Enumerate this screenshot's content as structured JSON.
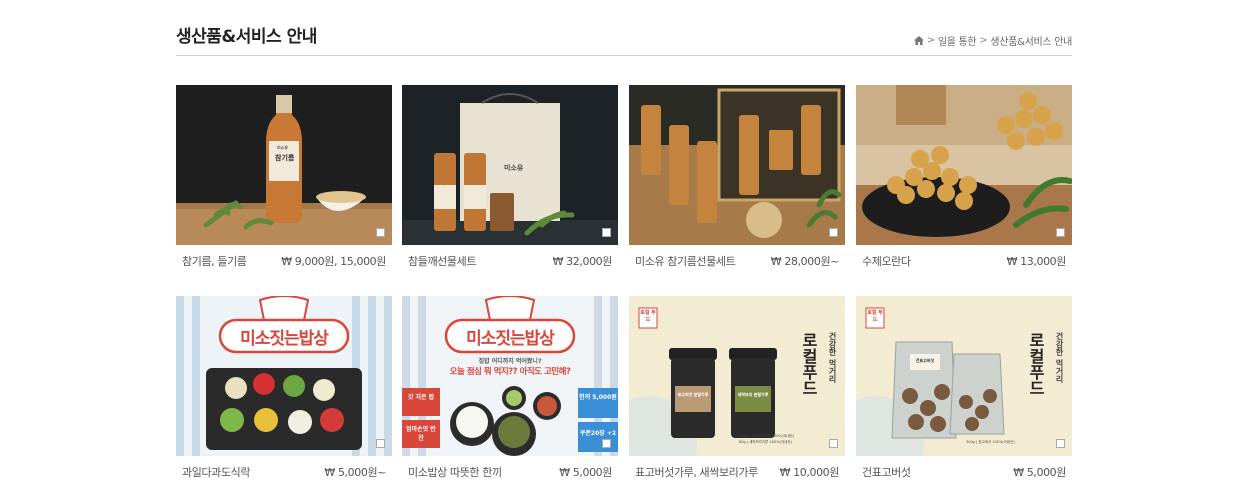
{
  "header": {
    "title": "생산품&서비스 안내",
    "breadcrumb": [
      {
        "icon": "home-icon"
      },
      {
        "label": "일을 통한"
      },
      {
        "label": "생산품&서비스 안내"
      }
    ]
  },
  "products": [
    {
      "name": "참기름, 들기름",
      "price": "₩ 9,000원, 15,000원",
      "image_text": [
        "미소유",
        "참기름"
      ]
    },
    {
      "name": "참들깨선물세트",
      "price": "₩ 32,000원",
      "image_text": [
        "미소유"
      ]
    },
    {
      "name": "미소유 참기름선물세트",
      "price": "₩ 28,000원~",
      "image_text": []
    },
    {
      "name": "수제오란다",
      "price": "₩ 13,000원",
      "image_text": []
    },
    {
      "name": "과일다과도식락",
      "price": "₩ 5,000원~",
      "image_text": [
        "미소짓는밥상"
      ]
    },
    {
      "name": "미소밥상 따뜻한 한끼",
      "price": "₩ 5,000원",
      "image_text": [
        "미소짓는밥상",
        "집밥 어디까지 먹어봤니?",
        "오늘 점심 뭐 먹지?? 아직도 고민해?",
        "갓 지은 밥",
        "엄마손맛 반찬",
        "한끼 5,000원",
        "쿠폰20장 +2"
      ]
    },
    {
      "name": "표고버섯가루, 새싹보리가루",
      "price": "₩ 10,000원",
      "image_text": [
        "로컬 푸드",
        "로컬푸드",
        "건강한 먹거리",
        "표고버섯 분말가루",
        "새싹보리 분말가루",
        "140g | 표고버섯가루 100%(국내산)",
        "80g | 새싹보리가루 100%(국내산)"
      ]
    },
    {
      "name": "건표고버섯",
      "price": "₩ 5,000원",
      "image_text": [
        "로컬 푸드",
        "로컬푸드",
        "건강한 먹거리",
        "건표고버섯",
        "300g | 표고버섯 100%(국내산)"
      ]
    }
  ],
  "colors": {
    "title": "#222222",
    "divider": "#cfcfcf",
    "meal_red": "#d9473b",
    "meal_blue": "#3a8fd6",
    "local_cream": "#f4ecd2"
  }
}
